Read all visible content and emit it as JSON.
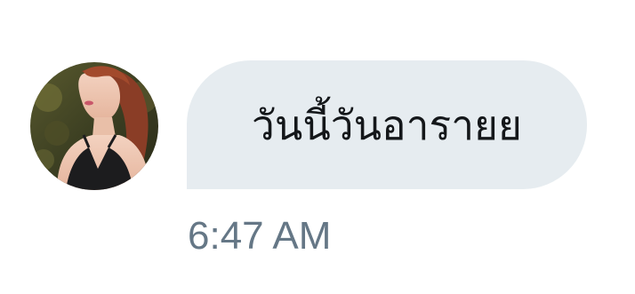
{
  "message": {
    "text": "วันนี้วันอารายย",
    "timestamp": "6:47 AM"
  },
  "avatar": {
    "icon": "user-avatar-photo"
  },
  "colors": {
    "bubble_background": "#e6ecf0",
    "message_text": "#14171a",
    "timestamp_text": "#657786",
    "page_background": "#ffffff"
  }
}
